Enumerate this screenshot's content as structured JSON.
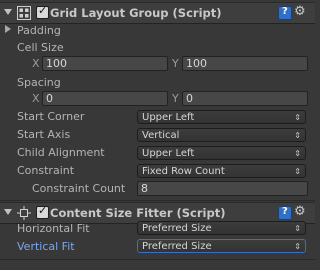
{
  "grid": {
    "title": "Grid Layout Group (Script)",
    "padding_label": "Padding",
    "cell_size_label": "Cell Size",
    "cell_size": {
      "x_label": "X",
      "x": "100",
      "y_label": "Y",
      "y": "100"
    },
    "spacing_label": "Spacing",
    "spacing": {
      "x_label": "X",
      "x": "0",
      "y_label": "Y",
      "y": "0"
    },
    "start_corner_label": "Start Corner",
    "start_corner": "Upper Left",
    "start_axis_label": "Start Axis",
    "start_axis": "Vertical",
    "child_alignment_label": "Child Alignment",
    "child_alignment": "Upper Left",
    "constraint_label": "Constraint",
    "constraint": "Fixed Row Count",
    "constraint_count_label": "Constraint Count",
    "constraint_count": "8"
  },
  "fitter": {
    "title": "Content Size Fitter (Script)",
    "horizontal_fit_label": "Horizontal Fit",
    "horizontal_fit": "Preferred Size",
    "vertical_fit_label": "Vertical Fit",
    "vertical_fit": "Preferred Size"
  },
  "icons": {
    "grid": "grid-layout-icon",
    "fitter": "content-size-fitter-icon",
    "help": "help-icon",
    "settings": "gear-icon",
    "dropdown_arrows": "⇕"
  },
  "colors": {
    "background": "#383838",
    "focused_label": "#7ba7ea",
    "focused_border": "#3a6fc2"
  }
}
